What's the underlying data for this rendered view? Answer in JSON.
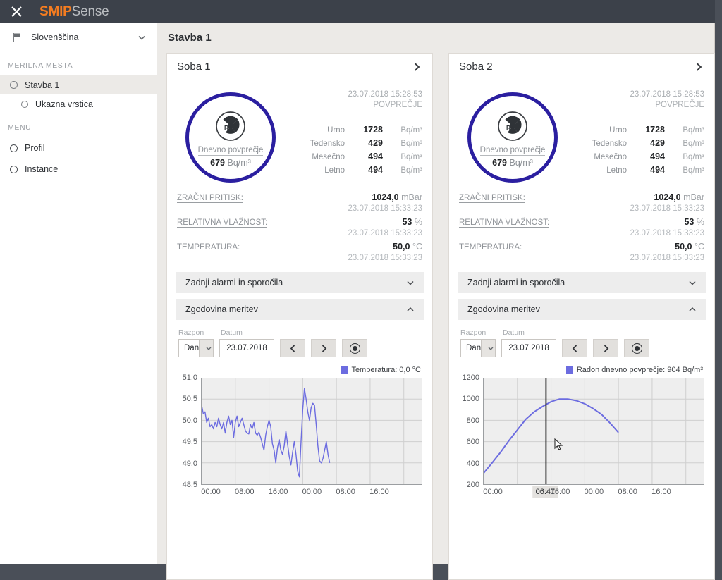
{
  "topbar": {
    "close_icon": "close-icon",
    "brand_primary": "SMIP",
    "brand_secondary": "Sense",
    "brand_color": "#f47c20",
    "bg_color": "#3c414a"
  },
  "sidebar": {
    "language": {
      "icon": "flag-icon",
      "label": "Slovenščina",
      "chevron": "chevron-down-icon"
    },
    "sections": [
      {
        "title": "MERILNA MESTA",
        "items": [
          {
            "label": "Stavba 1",
            "active": true,
            "sub": false
          },
          {
            "label": "Ukazna vrstica",
            "active": false,
            "sub": true
          }
        ]
      },
      {
        "title": "MENU",
        "items": [
          {
            "label": "Profil",
            "active": false,
            "sub": false
          },
          {
            "label": "Instance",
            "active": false,
            "sub": false
          }
        ]
      }
    ]
  },
  "main": {
    "page_title": "Stavba 1",
    "cards": [
      {
        "title": "Soba 1",
        "arrow_icon": "chevron-right-icon",
        "gauge": {
          "icon": "radiation-icon",
          "symbol": "Rn",
          "label": "Dnevno povprečje",
          "value": "679",
          "unit": "Bq/m³",
          "ring_color": "#2b1fa0"
        },
        "averages": {
          "timestamp": "23.07.2018 15:28:53",
          "caption": "POVPREČJE",
          "rows": [
            {
              "name": "Urno",
              "value": "1728",
              "unit": "Bq/m³",
              "underline": false
            },
            {
              "name": "Tedensko",
              "value": "429",
              "unit": "Bq/m³",
              "underline": false
            },
            {
              "name": "Mesečno",
              "value": "494",
              "unit": "Bq/m³",
              "underline": false
            },
            {
              "name": "Letno",
              "value": "494",
              "unit": "Bq/m³",
              "underline": true
            }
          ]
        },
        "sensors": [
          {
            "name": "ZRAČNI PRITISK:",
            "value": "1024,0",
            "unit": "mBar",
            "timestamp": "23.07.2018 15:33:23"
          },
          {
            "name": "RELATIVNA VLAŽNOST:",
            "value": "53",
            "unit": "%",
            "timestamp": "23.07.2018 15:33:23"
          },
          {
            "name": "TEMPERATURA:",
            "value": "50,0",
            "unit": "°C",
            "timestamp": "23.07.2018 15:33:23"
          }
        ],
        "accordions": [
          {
            "label": "Zadnji alarmi in sporočila",
            "icon": "chevron-down-icon",
            "expanded": false
          },
          {
            "label": "Zgodovina meritev",
            "icon": "chevron-up-icon",
            "expanded": true
          }
        ],
        "controls": {
          "range_label": "Razpon",
          "date_label": "Datum",
          "range_value": "Dan",
          "date_value": "23.07.2018",
          "prev_icon": "chevron-left-icon",
          "next_icon": "chevron-right-icon",
          "record_icon": "record-icon"
        }
      },
      {
        "title": "Soba 2",
        "arrow_icon": "chevron-right-icon",
        "gauge": {
          "icon": "radiation-icon",
          "symbol": "Rn",
          "label": "Dnevno povprečje",
          "value": "679",
          "unit": "Bq/m³",
          "ring_color": "#2b1fa0"
        },
        "averages": {
          "timestamp": "23.07.2018 15:28:53",
          "caption": "POVPREČJE",
          "rows": [
            {
              "name": "Urno",
              "value": "1728",
              "unit": "Bq/m³",
              "underline": false
            },
            {
              "name": "Tedensko",
              "value": "429",
              "unit": "Bq/m³",
              "underline": false
            },
            {
              "name": "Mesečno",
              "value": "494",
              "unit": "Bq/m³",
              "underline": false
            },
            {
              "name": "Letno",
              "value": "494",
              "unit": "Bq/m³",
              "underline": true
            }
          ]
        },
        "sensors": [
          {
            "name": "ZRAČNI PRITISK:",
            "value": "1024,0",
            "unit": "mBar",
            "timestamp": "23.07.2018 15:33:23"
          },
          {
            "name": "RELATIVNA VLAŽNOST:",
            "value": "53",
            "unit": "%",
            "timestamp": "23.07.2018 15:33:23"
          },
          {
            "name": "TEMPERATURA:",
            "value": "50,0",
            "unit": "°C",
            "timestamp": "23.07.2018 15:33:23"
          }
        ],
        "accordions": [
          {
            "label": "Zadnji alarmi in sporočila",
            "icon": "chevron-down-icon",
            "expanded": false
          },
          {
            "label": "Zgodovina meritev",
            "icon": "chevron-up-icon",
            "expanded": true
          }
        ],
        "controls": {
          "range_label": "Razpon",
          "date_label": "Datum",
          "range_value": "Dan",
          "date_value": "23.07.2018",
          "prev_icon": "chevron-left-icon",
          "next_icon": "chevron-right-icon",
          "record_icon": "record-icon"
        }
      }
    ]
  },
  "chart_data": [
    {
      "type": "line",
      "title": "",
      "legend": [
        "Temperatura: 0,0 °C"
      ],
      "legend_position": "top-right",
      "series_name": "Temperatura",
      "series_color": "#6c6ce0",
      "xlabel": "",
      "ylabel": "",
      "ylim": [
        48.5,
        51.0
      ],
      "yticks": [
        "48.5",
        "49.0",
        "49.5",
        "50.0",
        "50.5",
        "51.0"
      ],
      "xticks": [
        "00:00",
        "08:00",
        "16:00",
        "00:00",
        "08:00",
        "16:00"
      ],
      "grid": true,
      "x": [
        0.0,
        0.5,
        1.0,
        1.5,
        2.0,
        2.5,
        3.0,
        3.5,
        4.0,
        4.5,
        5.0,
        5.5,
        6.0,
        6.5,
        7.0,
        7.5,
        8.0,
        8.5,
        9.0,
        9.5,
        10.0,
        10.5,
        11.0,
        11.5,
        12.0,
        12.5,
        13.0,
        13.5,
        14.0,
        14.5,
        15.0,
        15.5,
        16.0,
        16.5,
        17.0,
        17.5,
        18.0,
        18.5,
        19.0,
        19.5,
        20.0,
        20.5,
        21.0,
        21.5,
        22.0,
        22.5,
        23.0,
        23.5,
        24.0,
        24.5,
        25.0,
        25.5,
        26.0,
        26.5,
        27.0,
        27.5,
        28.0,
        28.5,
        29.0,
        29.5,
        30.0,
        30.5,
        31.0,
        31.5,
        32.0,
        32.5,
        33.0,
        33.5,
        34.0,
        34.5,
        35.0,
        35.5,
        36.0,
        36.5,
        37.0,
        37.5,
        38.0,
        38.5,
        39.0,
        39.5,
        40.0
      ],
      "values": [
        50.35,
        50.15,
        50.2,
        49.95,
        50.05,
        49.85,
        49.9,
        49.8,
        49.95,
        49.85,
        50.05,
        49.9,
        49.8,
        49.95,
        49.7,
        49.95,
        50.1,
        49.9,
        50.0,
        49.6,
        49.95,
        50.1,
        49.85,
        49.95,
        50.05,
        49.9,
        49.75,
        49.7,
        49.68,
        49.9,
        49.8,
        49.95,
        49.7,
        49.65,
        49.72,
        49.6,
        49.45,
        49.3,
        49.65,
        49.85,
        50.0,
        49.85,
        49.45,
        49.3,
        49.0,
        49.35,
        49.55,
        49.3,
        49.2,
        49.4,
        49.75,
        49.45,
        49.15,
        48.95,
        49.25,
        49.5,
        49.2,
        48.8,
        48.67,
        49.5,
        50.25,
        50.75,
        50.5,
        50.2,
        50.0,
        50.3,
        50.4,
        50.35,
        49.9,
        49.4,
        49.05,
        49.0,
        49.1,
        49.3,
        49.5,
        49.2,
        49.0,
        null,
        null,
        null,
        null
      ]
    },
    {
      "type": "line",
      "title": "",
      "legend": [
        "Radon dnevno povprečje: 904 Bq/m³"
      ],
      "legend_position": "top-right",
      "series_name": "Radon dnevno povprečje",
      "series_color": "#6c6ce0",
      "xlabel": "",
      "ylabel": "",
      "ylim": [
        200,
        1200
      ],
      "yticks": [
        "200",
        "400",
        "600",
        "800",
        "1000",
        "1200"
      ],
      "xticks": [
        "00:00",
        "06:47",
        "16:00",
        "00:00",
        "08:00",
        "16:00"
      ],
      "cursor_label": "06:47",
      "cursor_value": "904",
      "grid": true,
      "x": [
        0,
        1,
        2,
        3,
        4,
        5,
        6,
        7,
        8,
        9,
        10,
        11,
        12,
        13,
        14,
        15,
        16
      ],
      "values": [
        305,
        400,
        500,
        610,
        710,
        810,
        880,
        930,
        975,
        1000,
        1000,
        985,
        955,
        910,
        855,
        775,
        685
      ]
    }
  ]
}
